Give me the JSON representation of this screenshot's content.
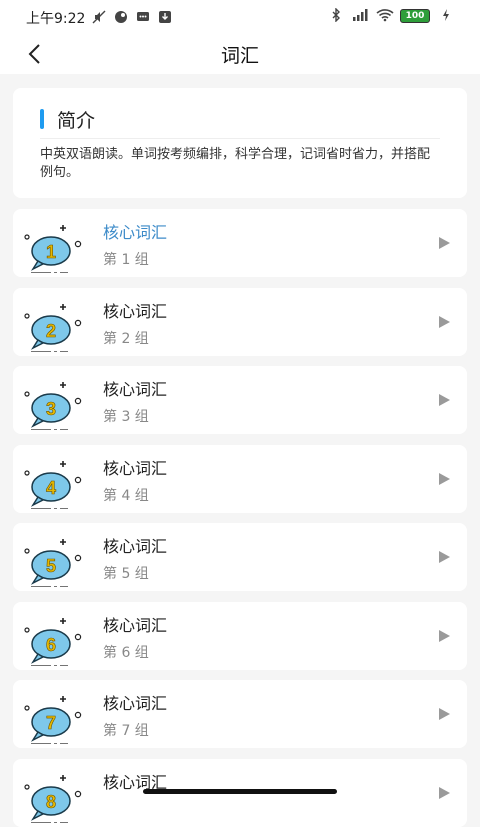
{
  "status_bar": {
    "time": "上午9:22",
    "battery": "100"
  },
  "header": {
    "title": "词汇"
  },
  "intro": {
    "heading": "简介",
    "description": "中英双语朗读。单词按考频编排，科学合理，记词省时省力，并搭配例句。"
  },
  "groups": [
    {
      "number": "1",
      "title": "核心词汇",
      "subtitle": "第 1 组"
    },
    {
      "number": "2",
      "title": "核心词汇",
      "subtitle": "第 2 组"
    },
    {
      "number": "3",
      "title": "核心词汇",
      "subtitle": "第 3 组"
    },
    {
      "number": "4",
      "title": "核心词汇",
      "subtitle": "第 4 组"
    },
    {
      "number": "5",
      "title": "核心词汇",
      "subtitle": "第 5 组"
    },
    {
      "number": "6",
      "title": "核心词汇",
      "subtitle": "第 6 组"
    },
    {
      "number": "7",
      "title": "核心词汇",
      "subtitle": "第 7 组"
    },
    {
      "number": "8",
      "title": "核心词汇",
      "subtitle": ""
    }
  ],
  "colors": {
    "accent": "#1e9bf0",
    "active_title": "#3d8bc9",
    "bubble_fill": "#7ec8ea",
    "bubble_number": "#e6b800"
  }
}
